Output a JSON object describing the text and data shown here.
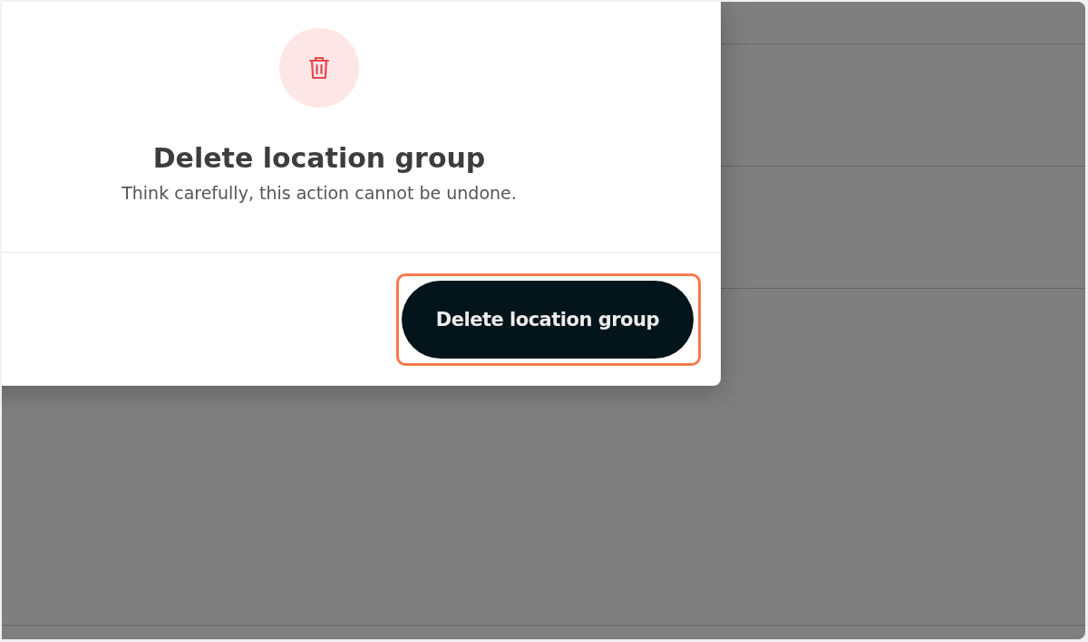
{
  "dialog": {
    "title": "Delete location group",
    "message": "Think carefully, this action cannot be undone.",
    "confirm_button": {
      "label": "Delete location group",
      "highlighted": true
    }
  }
}
